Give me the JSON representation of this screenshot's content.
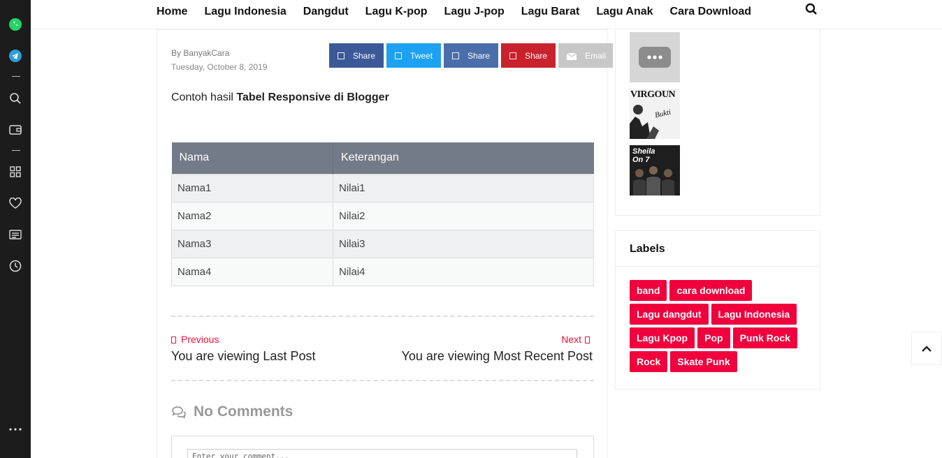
{
  "nav": {
    "items": [
      "Home",
      "Lagu Indonesia",
      "Dangdut",
      "Lagu K-pop",
      "Lagu J-pop",
      "Lagu Barat",
      "Lagu Anak",
      "Cara Download"
    ]
  },
  "post": {
    "author": "By BanyakCara",
    "date": "Tuesday, October 8, 2019",
    "intro_prefix": "Contoh hasil ",
    "intro_bold": "Tabel Responsive di Blogger"
  },
  "share": [
    {
      "label": "Share",
      "color": "#3b5998"
    },
    {
      "label": "Tweet",
      "color": "#1da1f2"
    },
    {
      "label": "Share",
      "color": "#4a6ea9"
    },
    {
      "label": "Share",
      "color": "#c8232c"
    },
    {
      "label": "Email",
      "color": "#c7c7c7"
    }
  ],
  "table": {
    "headers": [
      "Nama",
      "Keterangan"
    ],
    "rows": [
      [
        "Nama1",
        "Nilai1"
      ],
      [
        "Nama2",
        "Nilai2"
      ],
      [
        "Nama3",
        "Nilai3"
      ],
      [
        "Nama4",
        "Nilai4"
      ]
    ]
  },
  "pager": {
    "prev_label": "Previous",
    "prev_title": "You are viewing Last Post",
    "next_label": "Next",
    "next_title": "You are viewing Most Recent Post"
  },
  "comments": {
    "title": "No Comments",
    "placeholder": "Enter your comment..."
  },
  "sidebar": {
    "thumb_texts": [
      "VIRGOUN",
      "Bukti",
      "Sheila On 7"
    ],
    "labels_title": "Labels",
    "labels": [
      "band",
      "cara download",
      "Lagu dangdut",
      "Lagu Indonesia",
      "Lagu Kpop",
      "Pop",
      "Punk Rock",
      "Rock",
      "Skate Punk"
    ]
  },
  "colors": {
    "accent": "#f0003c",
    "table_header": "#737b88",
    "rail": "#1c1c1c"
  }
}
